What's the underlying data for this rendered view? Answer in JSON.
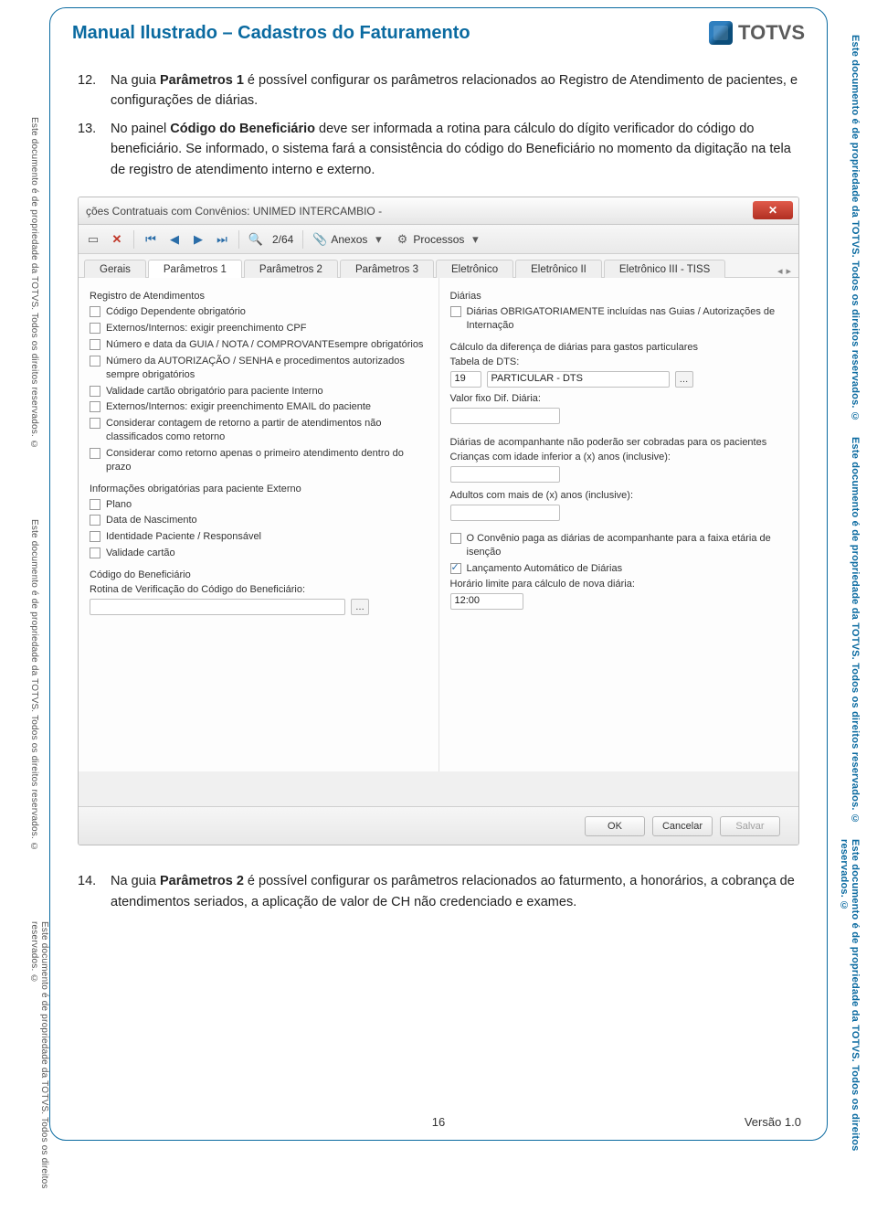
{
  "doc": {
    "title": "Manual Ilustrado – Cadastros do Faturamento",
    "logo_text": "TOTVS",
    "page_number": "16",
    "version": "Versão 1.0"
  },
  "watermark": {
    "left": "Este documento é de propriedade da TOTVS. Todos os direitos reservados. ©",
    "right": "Este documento é de propriedade da TOTVS. Todos os direitos reservados. ©"
  },
  "paragraphs": {
    "p12_num": "12.",
    "p12_a": "Na guia ",
    "p12_b": "Parâmetros 1",
    "p12_c": " é possível configurar os parâmetros relacionados ao Registro de Atendimento de pacientes, e configurações de diárias.",
    "p13_num": "13.",
    "p13_a": "No painel ",
    "p13_b": "Código do Beneficiário",
    "p13_c": " deve ser informada a rotina para cálculo do dígito verificador do código do beneficiário. Se informado, o sistema fará a consistência do código do Beneficiário no momento da digitação na tela de registro de atendimento interno e externo.",
    "p14_num": "14.",
    "p14_a": "Na guia ",
    "p14_b": "Parâmetros 2",
    "p14_c": " é possível configurar os parâmetros relacionados ao faturmento, a honorários, a cobrança de atendimentos seriados, a aplicação de valor de CH não credenciado e exames."
  },
  "window": {
    "title": "ções Contratuais com Convênios: UNIMED INTERCAMBIO -",
    "record_pos": "2/64",
    "anexos": "Anexos",
    "processos": "Processos"
  },
  "tabs": {
    "t1": "Gerais",
    "t2": "Parâmetros 1",
    "t3": "Parâmetros 2",
    "t4": "Parâmetros 3",
    "t5": "Eletrônico",
    "t6": "Eletrônico II",
    "t7": "Eletrônico III - TISS"
  },
  "left_panel": {
    "group1": "Registro de Atendimentos",
    "c1": "Código Dependente obrigatório",
    "c2": "Externos/Internos: exigir preenchimento CPF",
    "c3": "Número e data da GUIA / NOTA / COMPROVANTEsempre obrigatórios",
    "c4": "Número da AUTORIZAÇÃO / SENHA e procedimentos autorizados sempre obrigatórios",
    "c5": "Validade cartão obrigatório para paciente Interno",
    "c6": "Externos/Internos: exigir preenchimento EMAIL do paciente",
    "c7": "Considerar contagem de retorno a partir de atendimentos não classificados como retorno",
    "c8": "Considerar como retorno apenas o primeiro atendimento dentro do prazo",
    "group2": "Informações obrigatórias para paciente Externo",
    "c9": "Plano",
    "c10": "Data de Nascimento",
    "c11": "Identidade Paciente / Responsável",
    "c12": "Validade cartão",
    "group3": "Código do Beneficiário",
    "rotina_label": "Rotina de Verificação do Código do Beneficiário:"
  },
  "right_panel": {
    "group1": "Diárias",
    "d1": "Diárias OBRIGATORIAMENTE incluídas nas Guias / Autorizações de Internação",
    "calc_label": "Cálculo da diferença de diárias para gastos particulares",
    "tabela_label": "Tabela de DTS:",
    "tabela_code": "19",
    "tabela_desc": "PARTICULAR - DTS",
    "valor_fixo": "Valor fixo Dif. Diária:",
    "acomp_label": "Diárias de acompanhante não poderão ser cobradas para os pacientes",
    "criancas": "Crianças com idade inferior a (x) anos (inclusive):",
    "adultos": "Adultos com mais de (x) anos (inclusive):",
    "conv_chk": "O Convênio paga as diárias de acompanhante para a faixa etária de isenção",
    "lanc_auto": "Lançamento Automático de Diárias",
    "horario_label": "Horário limite para cálculo de nova diária:",
    "horario_val": "12:00"
  },
  "buttons": {
    "ok": "OK",
    "cancelar": "Cancelar",
    "salvar": "Salvar"
  }
}
